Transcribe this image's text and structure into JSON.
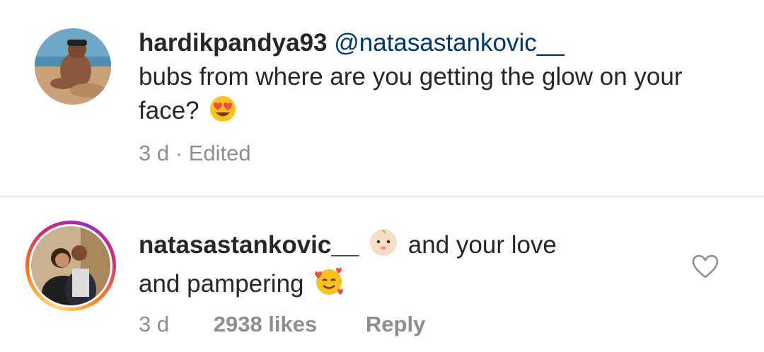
{
  "comments": [
    {
      "username": "hardikpandya93",
      "mention": "@natasastankovic__",
      "text": "bubs from where are you getting the glow on your face?",
      "emoji": "heart-eyes-emoji",
      "time": "3 d",
      "separator": "·",
      "edited": "Edited"
    },
    {
      "username": "natasastankovic__",
      "text_before": "and your love",
      "text_after": "and pampering",
      "emoji_1": "baby-emoji",
      "emoji_2": "smiling-face-with-hearts-emoji",
      "time": "3 d",
      "likes": "2938 likes",
      "reply": "Reply",
      "like_icon": "heart-outline-icon"
    }
  ],
  "colors": {
    "text": "#262626",
    "muted": "#8e8e8e",
    "mention": "#00376b",
    "divider": "#e2e2e2"
  }
}
